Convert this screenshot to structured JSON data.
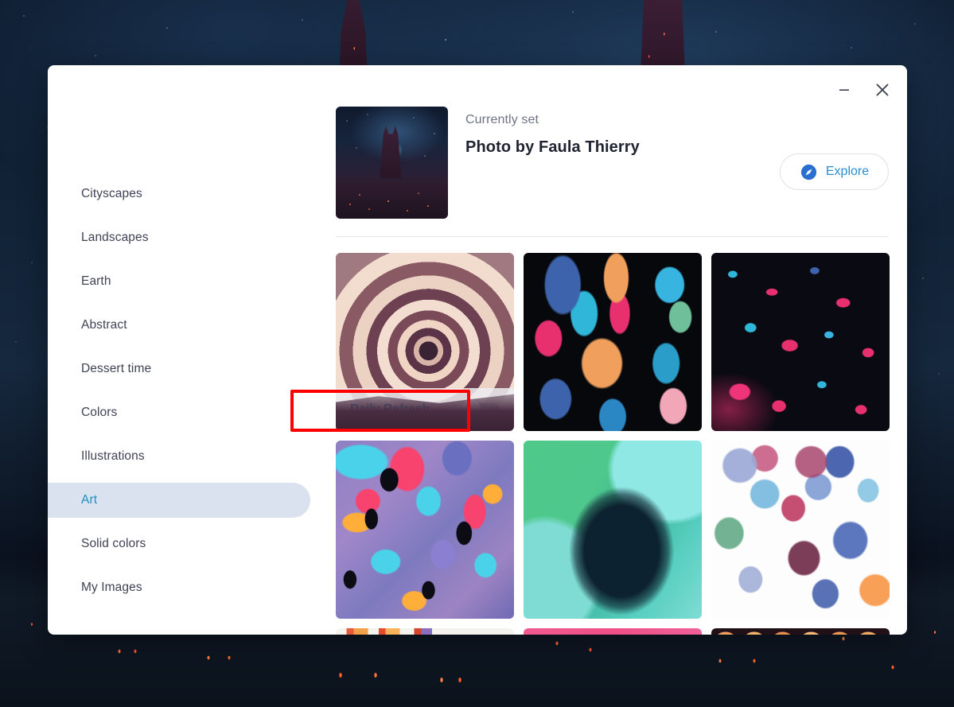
{
  "window": {
    "minimize_icon": "minimize-icon",
    "close_icon": "close-icon"
  },
  "sidebar": {
    "items": [
      {
        "label": "Cityscapes",
        "selected": false
      },
      {
        "label": "Landscapes",
        "selected": false
      },
      {
        "label": "Earth",
        "selected": false
      },
      {
        "label": "Abstract",
        "selected": false
      },
      {
        "label": "Dessert time",
        "selected": false
      },
      {
        "label": "Colors",
        "selected": false
      },
      {
        "label": "Illustrations",
        "selected": false
      },
      {
        "label": "Art",
        "selected": true
      },
      {
        "label": "Solid colors",
        "selected": false
      },
      {
        "label": "My Images",
        "selected": false
      }
    ]
  },
  "current": {
    "status_label": "Currently set",
    "title": "Photo by Faula Thierry",
    "thumbnail_name": "night-cityscape-cathedral"
  },
  "explore": {
    "label": "Explore",
    "icon": "compass-icon"
  },
  "daily_refresh": {
    "label": "Daily Refresh",
    "enabled": false,
    "toggle_state": "off"
  },
  "tiles": [
    {
      "name": "swirl-pastel-artwork",
      "style": "art-swirl",
      "has_daily_refresh": true
    },
    {
      "name": "paint-splash-on-black-artwork",
      "style": "art-splash-black",
      "has_daily_refresh": false
    },
    {
      "name": "pink-cyan-splatter-artwork",
      "style": "art-splatter-pink",
      "has_daily_refresh": false
    },
    {
      "name": "colorful-abstract-artwork",
      "style": "art-abstract-warm",
      "has_daily_refresh": false
    },
    {
      "name": "green-teal-watercolor-artwork",
      "style": "art-green-wash",
      "has_daily_refresh": false
    },
    {
      "name": "watercolor-blots-artwork",
      "style": "art-watercolor-blots",
      "has_daily_refresh": false
    },
    {
      "name": "warm-stripes-artwork",
      "style": "art-strip-warm",
      "partial": true
    },
    {
      "name": "pink-gradient-artwork",
      "style": "art-strip-pink",
      "partial": true
    },
    {
      "name": "dark-orange-arches-artwork",
      "style": "art-strip-dark",
      "partial": true
    }
  ],
  "annotation": {
    "color": "#ff0000",
    "target": "daily-refresh-toggle"
  },
  "colors": {
    "accent_blue": "#2a8fd0",
    "selected_pill": "#dae1ef",
    "text_primary": "#1f2330",
    "text_secondary": "#6f7486",
    "nav_text": "#3f4355",
    "dialog_background": "#ffffff"
  }
}
